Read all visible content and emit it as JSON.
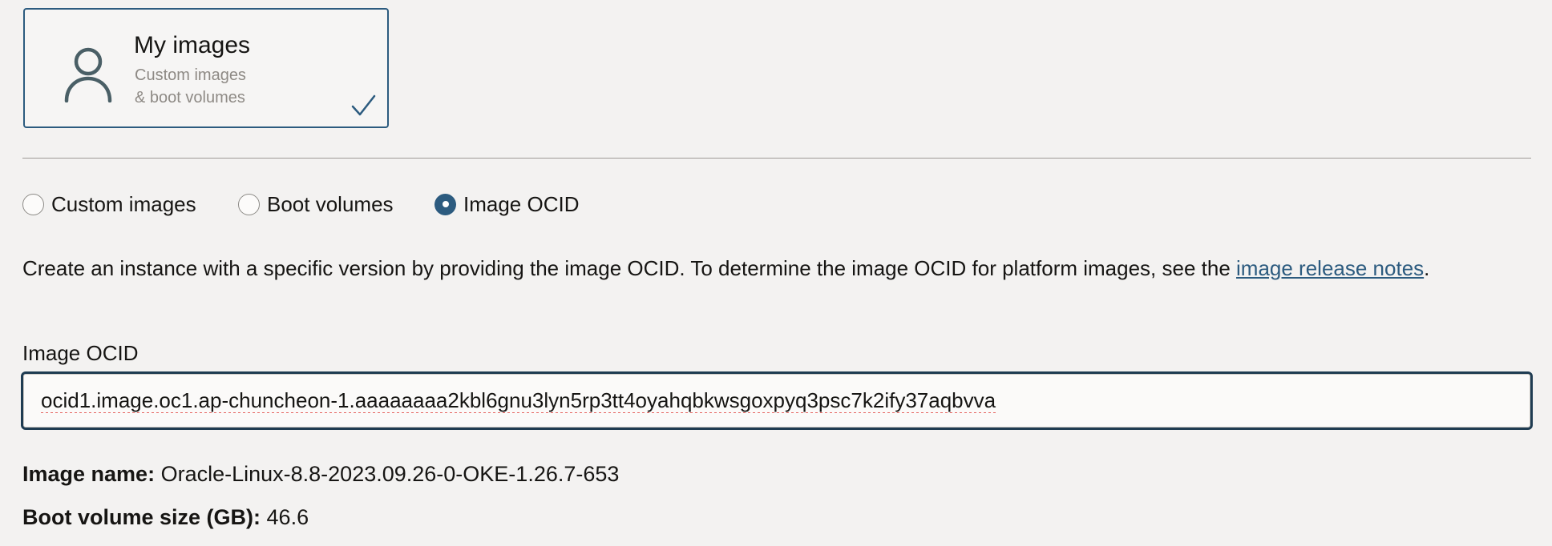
{
  "source_card": {
    "title": "My images",
    "subtitle_line1": "Custom images",
    "subtitle_line2": "& boot volumes",
    "icon": "user-icon",
    "selected_icon": "check-icon",
    "accent_color": "#2c5b7f"
  },
  "source_type": {
    "options": [
      {
        "label": "Custom images",
        "selected": false
      },
      {
        "label": "Boot volumes",
        "selected": false
      },
      {
        "label": "Image OCID",
        "selected": true
      }
    ]
  },
  "description": {
    "text_before": "Create an instance with a specific version by providing the image OCID. To determine the image OCID for platform images, see the ",
    "link_text": "image release notes",
    "text_after": "."
  },
  "image_ocid_field": {
    "label": "Image OCID",
    "value": "ocid1.image.oc1.ap-chuncheon-1.aaaaaaaa2kbl6gnu3lyn5rp3tt4oyahqbkwsgoxpyq3psc7k2ify37aqbvva"
  },
  "image_info": {
    "name_label": "Image name:",
    "name_value": "Oracle-Linux-8.8-2023.09.26-0-OKE-1.26.7-653",
    "boot_size_label": "Boot volume size (GB):",
    "boot_size_value": "46.6"
  }
}
